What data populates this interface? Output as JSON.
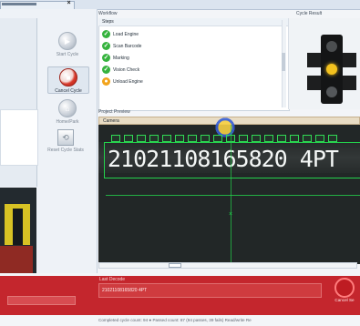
{
  "window": {
    "tab_close": "×"
  },
  "buttons": [
    {
      "label": "Start Cycle",
      "icon": "play-icon"
    },
    {
      "label": "Cancel Cycle",
      "icon": "stop-icon"
    },
    {
      "label": "Home/Park",
      "icon": "home-icon"
    },
    {
      "label": "Reset Cycle Stats",
      "icon": "reset-icon"
    }
  ],
  "workflow": {
    "title": "Workflow",
    "steps_header": "Steps",
    "steps": [
      "Load Engine",
      "Scan Barcode",
      "Marking",
      "Vision Check",
      "Unload Engine"
    ]
  },
  "cycle_result": {
    "title": "Cycle Result",
    "active_light": "yellow"
  },
  "project": {
    "title": "Project Preview",
    "camera_tab": "Camera",
    "code": "21021108165820 4PT",
    "x_marker": "×"
  },
  "last_decode": {
    "label": "Last Decode",
    "value": "21021108165820 4PT"
  },
  "cancel": {
    "label": "Cancel Se"
  },
  "status": {
    "text": "Completed cycle count: 94 ● Passed count: 87 (94 passes, 39 fails) Read/write Re"
  },
  "colors": {
    "accent_red": "#c21d24",
    "ok_green": "#36b33e",
    "warning_yellow": "#f4c21e"
  }
}
